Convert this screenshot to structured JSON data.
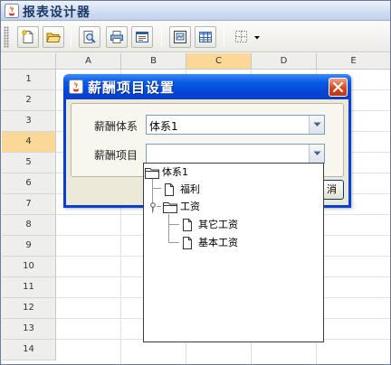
{
  "window": {
    "title": "报表设计器"
  },
  "toolbar": {
    "buttons": [
      {
        "name": "new-report-button",
        "icon": "new-document-icon"
      },
      {
        "name": "open-button",
        "icon": "open-folder-icon"
      },
      {
        "name": "preview-button",
        "icon": "preview-icon"
      },
      {
        "name": "print-button",
        "icon": "printer-icon"
      },
      {
        "name": "properties-button",
        "icon": "report-properties-icon"
      },
      {
        "name": "page-setup-button",
        "icon": "page-setup-icon"
      },
      {
        "name": "table-button",
        "icon": "table-icon"
      },
      {
        "name": "border-dropdown-button",
        "icon": "border-icon"
      }
    ]
  },
  "sheet": {
    "columns": [
      "A",
      "B",
      "C",
      "D",
      "E"
    ],
    "rows": [
      "1",
      "2",
      "3",
      "4",
      "5",
      "6",
      "7",
      "8",
      "9",
      "10",
      "11",
      "12",
      "13",
      "14"
    ],
    "selected_column": "C",
    "selected_row": "4"
  },
  "dialog": {
    "title": "薪酬项目设置",
    "system_label": "薪酬体系",
    "system_value": "体系1",
    "item_label": "薪酬项目",
    "item_value": "",
    "button_partial": "消"
  },
  "tree": {
    "root": "体系1",
    "children": [
      {
        "label": "福利",
        "type": "file"
      },
      {
        "label": "工资",
        "type": "folder",
        "children": [
          "其它工资",
          "基本工资"
        ]
      }
    ]
  },
  "colors": {
    "dialog_title": "#0a5de6",
    "selection_header": "#fbd897",
    "close_button": "#d8461f"
  }
}
